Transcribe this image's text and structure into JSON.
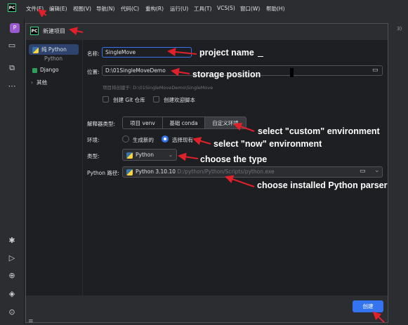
{
  "app": {
    "logo_text": "PC",
    "project_badge": "P"
  },
  "menubar": {
    "items": [
      "文件(F)",
      "编辑(E)",
      "视图(V)",
      "导航(N)",
      "代码(C)",
      "重构(R)",
      "运行(U)",
      "工具(T)",
      "VCS(S)",
      "窗口(W)",
      "帮助(H)"
    ],
    "right_fragment": "3)"
  },
  "dialog": {
    "title": "新建项目",
    "sidebar": {
      "selected_item": "纯 Python",
      "group_label": "Python",
      "items": [
        "Django"
      ],
      "more_label": "其他"
    },
    "form": {
      "name_label": "名称:",
      "name_value": "SingleMove",
      "location_label": "位置:",
      "location_value": "D:\\01SingleMoveDemo",
      "location_hint": "项目将创建于: D:\\01SingleMoveDemo\\SingleMove",
      "git_checkbox_label": "创建 Git 仓库",
      "welcome_checkbox_label": "创建欢迎脚本",
      "interpreter_type_label": "解释器类型:",
      "interpreter_tabs": [
        "项目 venv",
        "基础 conda",
        "自定义环境"
      ],
      "interpreter_tab_selected": "自定义环境",
      "env_label": "环境:",
      "env_options": [
        "生成新的",
        "选择现有"
      ],
      "env_selected": "选择现有",
      "type_label": "类型:",
      "type_value": "Python",
      "python_path_label": "Python 路径:",
      "python_version": "Python 3.10.10",
      "python_path": "D:/python/Python/Scripts/python.exe"
    },
    "create_button": "创建"
  },
  "annotations": {
    "project_name": "project name",
    "storage_position": "storage position",
    "custom_env": "select \"custom\" environment",
    "now_env": "select \"now\" environment",
    "choose_type": "choose the type",
    "choose_parser": "choose installed Python parser",
    "arrow_color": "#e0202a"
  }
}
